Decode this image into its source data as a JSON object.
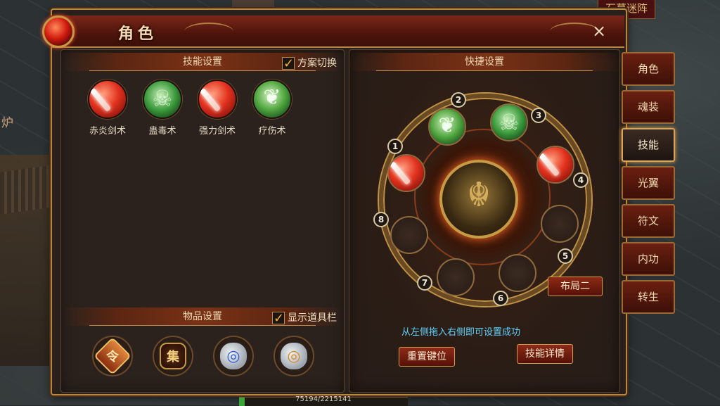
{
  "window": {
    "title": "角色",
    "close_icon": "×"
  },
  "tabs": [
    {
      "label": "角色",
      "active": false
    },
    {
      "label": "魂装",
      "active": false
    },
    {
      "label": "技能",
      "active": true
    },
    {
      "label": "光翼",
      "active": false
    },
    {
      "label": "符文",
      "active": false
    },
    {
      "label": "内功",
      "active": false
    },
    {
      "label": "转生",
      "active": false
    }
  ],
  "skill_settings": {
    "header": "技能设置",
    "scheme_toggle_label": "方案切换",
    "scheme_toggle_checked": true,
    "skills": [
      {
        "name": "赤炎剑术",
        "icon": "fire-sword-icon"
      },
      {
        "name": "蛊毒术",
        "icon": "poison-skull-icon"
      },
      {
        "name": "强力剑术",
        "icon": "power-sword-icon"
      },
      {
        "name": "疗伤术",
        "icon": "heal-leaf-icon"
      }
    ]
  },
  "item_settings": {
    "header": "物品设置",
    "show_toolbar_label": "显示道具栏",
    "show_toolbar_checked": true,
    "items": [
      {
        "icon": "command-token-icon",
        "glyph": "令"
      },
      {
        "icon": "gather-emblem-icon",
        "glyph": "集"
      },
      {
        "icon": "blue-stone-icon",
        "glyph": "◎"
      },
      {
        "icon": "gold-stone-icon",
        "glyph": "◎"
      }
    ]
  },
  "quick_settings": {
    "header": "快捷设置",
    "slots": [
      {
        "num": "1",
        "skill": "fire-sword-icon"
      },
      {
        "num": "2",
        "skill": "heal-leaf-icon"
      },
      {
        "num": "3",
        "skill": "poison-skull-icon"
      },
      {
        "num": "4",
        "skill": "power-sword-icon"
      },
      {
        "num": "5",
        "skill": ""
      },
      {
        "num": "6",
        "skill": ""
      },
      {
        "num": "7",
        "skill": ""
      },
      {
        "num": "8",
        "skill": ""
      }
    ],
    "layout_button": "布局二",
    "hint": "从左侧拖入右侧即可设置成功",
    "reset_button": "重置键位",
    "detail_button": "技能详情"
  },
  "world": {
    "sign_text": "石墓迷阵",
    "side_char": "炉",
    "exp_text": "75194/2215141",
    "exp_progress": 0.034
  }
}
